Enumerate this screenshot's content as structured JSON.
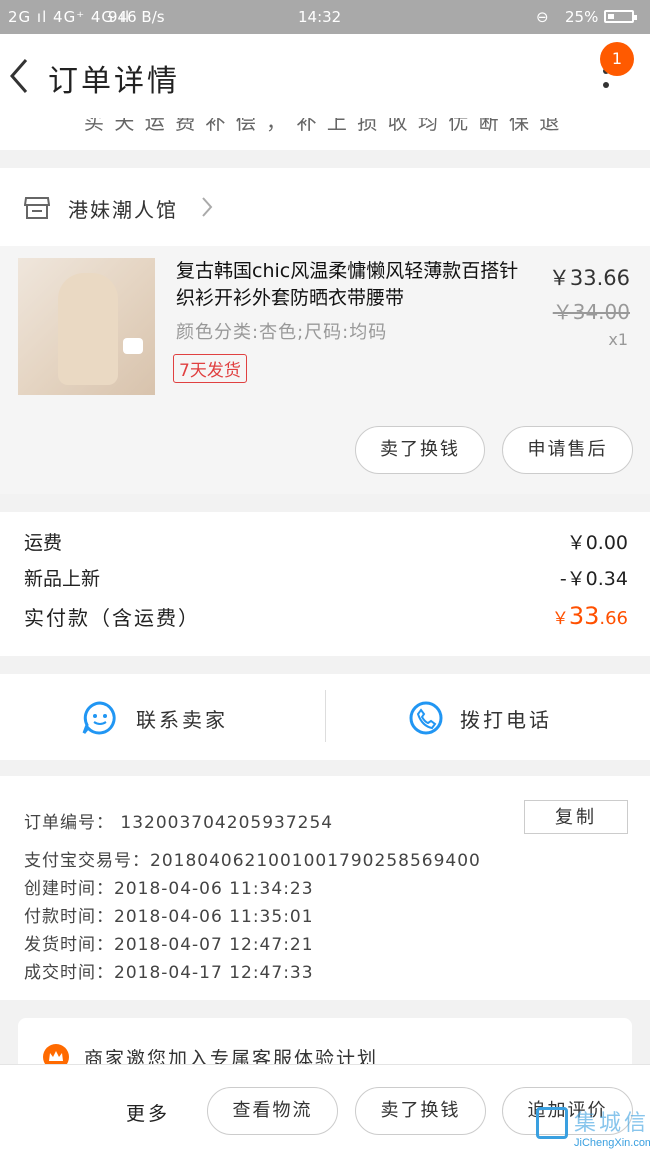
{
  "status_bar": {
    "signal": "2G ıl 4G⁺ 4G ıl",
    "net_speed": "946 B/s",
    "time": "14:32",
    "battery": "25%"
  },
  "navbar": {
    "title": "订单详情",
    "badge_count": "1"
  },
  "clipped_text": "买 天 运 费 补 偿 ， 补 上 损 收 均 优 断 保 退",
  "shop": {
    "name": "港妹潮人馆"
  },
  "product": {
    "title": "复古韩国chic风温柔慵懒风轻薄款百搭针织衫开衫外套防晒衣带腰带",
    "spec": "颜色分类:杏色;尺码:均码",
    "tag": "7天发货",
    "price": "￥33.66",
    "original_price": "￥34.00",
    "quantity": "x1",
    "actions": [
      "卖了换钱",
      "申请售后"
    ]
  },
  "fees": [
    {
      "label": "运费",
      "value": "￥0.00"
    },
    {
      "label": "新品上新",
      "value": "-￥0.34"
    }
  ],
  "total": {
    "label": "实付款（含运费）",
    "currency": "￥",
    "integer": "33",
    "decimal": ".66",
    "color": "#ff5000"
  },
  "contact": {
    "seller_label": "联系卖家",
    "phone_label": "拨打电话",
    "icon_color": "#2196f3"
  },
  "order_info": {
    "order_no_label": "订单编号：",
    "order_no": "132003704205937254",
    "copy_label": "复制",
    "rows": [
      {
        "label": "支付宝交易号：",
        "value": "2018040621001001790258569400"
      },
      {
        "label": "创建时间：",
        "value": "2018-04-06 11:34:23"
      },
      {
        "label": "付款时间：",
        "value": "2018-04-06 11:35:01"
      },
      {
        "label": "发货时间：",
        "value": "2018-04-07 12:47:21"
      },
      {
        "label": "成交时间：",
        "value": "2018-04-17 12:47:33"
      }
    ]
  },
  "promo": {
    "text": "商家邀您加入专属客服体验计划"
  },
  "bottom_bar": {
    "more": "更多",
    "buttons": [
      "查看物流",
      "卖了换钱",
      "追加评价"
    ]
  },
  "watermark": {
    "text": "集城信",
    "sub": "JiChengXin.com"
  }
}
